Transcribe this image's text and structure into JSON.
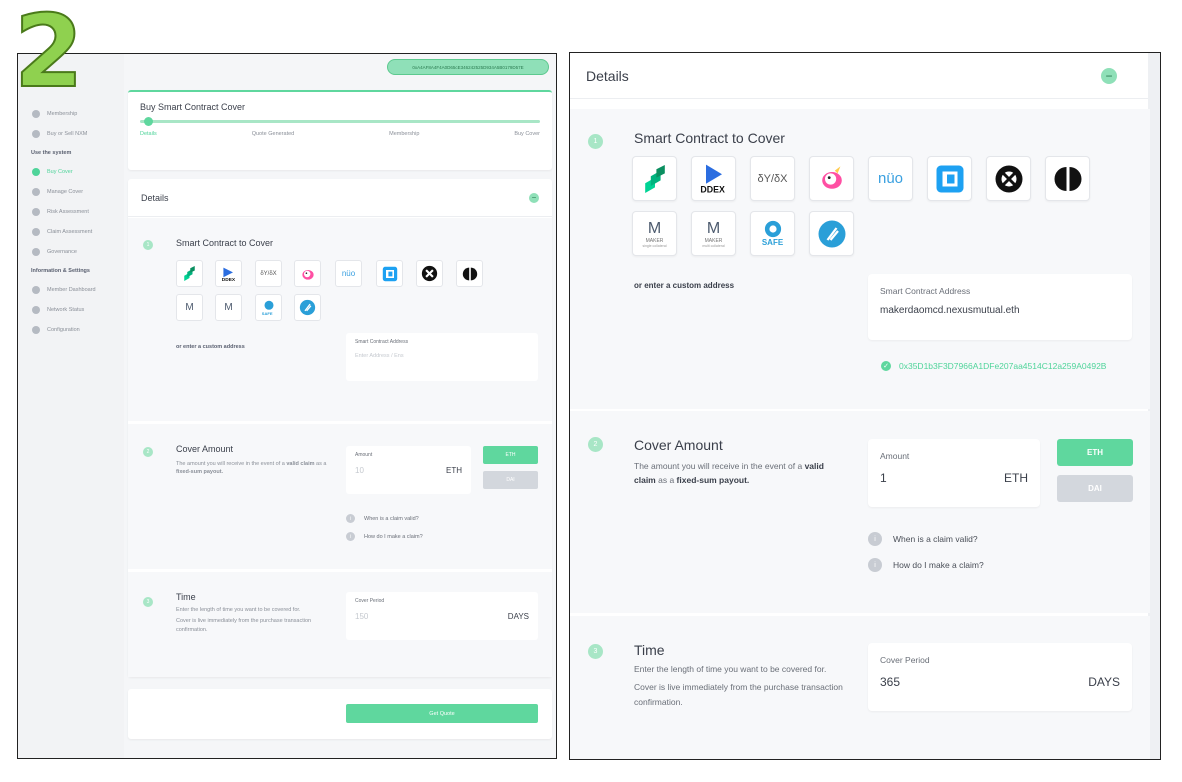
{
  "step_number": "2",
  "left": {
    "address": "0xA4AF8A4F4A0D65cE346242525D934A5B0179D57E",
    "sidebar": {
      "items_top": [
        {
          "label": "Membership",
          "icon": "membership-icon"
        },
        {
          "label": "Buy or Sell NXM",
          "icon": "exchange-icon"
        }
      ],
      "section1": "Use the system",
      "items_mid": [
        {
          "label": "Buy Cover",
          "icon": "buy-cover-icon"
        },
        {
          "label": "Manage Cover",
          "icon": "manage-cover-icon"
        },
        {
          "label": "Risk Assessment",
          "icon": "risk-icon"
        },
        {
          "label": "Claim Assessment",
          "icon": "claim-icon"
        },
        {
          "label": "Governance",
          "icon": "governance-icon"
        }
      ],
      "section2": "Information & Settings",
      "items_bot": [
        {
          "label": "Member Dashboard",
          "icon": "dashboard-icon"
        },
        {
          "label": "Network Status",
          "icon": "network-icon"
        },
        {
          "label": "Configuration",
          "icon": "config-icon"
        }
      ]
    },
    "progress": {
      "title": "Buy Smart Contract Cover",
      "steps": [
        "Details",
        "Quote Generated",
        "Membership",
        "Buy Cover"
      ]
    },
    "details_title": "Details",
    "sc_title": "Smart Contract to Cover",
    "custom_label": "or enter a custom address",
    "sc_address_label": "Smart Contract Address",
    "sc_address_placeholder": "Enter Address / Ens",
    "cover_title": "Cover Amount",
    "cover_desc_1": "The amount you will receive in the event of a ",
    "cover_desc_bold1": "valid claim",
    "cover_desc_2": " as a ",
    "cover_desc_bold2": "fixed-sum payout.",
    "amount_label": "Amount",
    "amount_placeholder": "10",
    "amount_unit": "ETH",
    "btn_eth": "ETH",
    "btn_dai": "DAI",
    "info1": "When is a claim valid?",
    "info2": "How do I make a claim?",
    "time_title": "Time",
    "time_desc1": "Enter the length of time you want to be covered for.",
    "time_desc2": "Cover is live immediately from the purchase transaction confirmation.",
    "period_label": "Cover Period",
    "period_placeholder": "150",
    "period_unit": "DAYS",
    "quote_btn": "Get Quote",
    "nums": [
      "1",
      "2",
      "3"
    ]
  },
  "right": {
    "details_title": "Details",
    "sc_title": "Smart Contract to Cover",
    "logos": {
      "ddex": "DDEX",
      "ratio": "δY/δX",
      "nuo": "nüo",
      "maker1": "MAKER",
      "maker1_sub": "single collateral",
      "maker2": "MAKER",
      "maker2_sub": "multi collateral",
      "safe": "SAFE"
    },
    "custom_label": "or enter a custom address",
    "sc_address_label": "Smart Contract Address",
    "sc_address_value": "makerdaomcd.nexusmutual.eth",
    "resolved_address": "0x35D1b3F3D7966A1DFe207aa4514C12a259A0492B",
    "cover_title": "Cover Amount",
    "cover_desc_1": "The amount you will receive in the event of a ",
    "cover_desc_bold1": "valid",
    "cover_desc_bold1b": "claim",
    "cover_desc_2": " as a ",
    "cover_desc_bold2": "fixed-sum payout.",
    "amount_label": "Amount",
    "amount_value": "1",
    "amount_unit": "ETH",
    "btn_eth": "ETH",
    "btn_dai": "DAI",
    "info1": "When is a claim valid?",
    "info2": "How do I make a claim?",
    "time_title": "Time",
    "time_desc1": "Enter the length of time you want to be covered for.",
    "time_desc2": "Cover is live immediately from the purchase transaction confirmation.",
    "period_label": "Cover Period",
    "period_value": "365",
    "period_unit": "DAYS",
    "nums": [
      "1",
      "2",
      "3"
    ]
  },
  "colors": {
    "accent": "#5fd79e",
    "accent_light": "#a8e6c6",
    "step_badge": "#8fd14f"
  }
}
